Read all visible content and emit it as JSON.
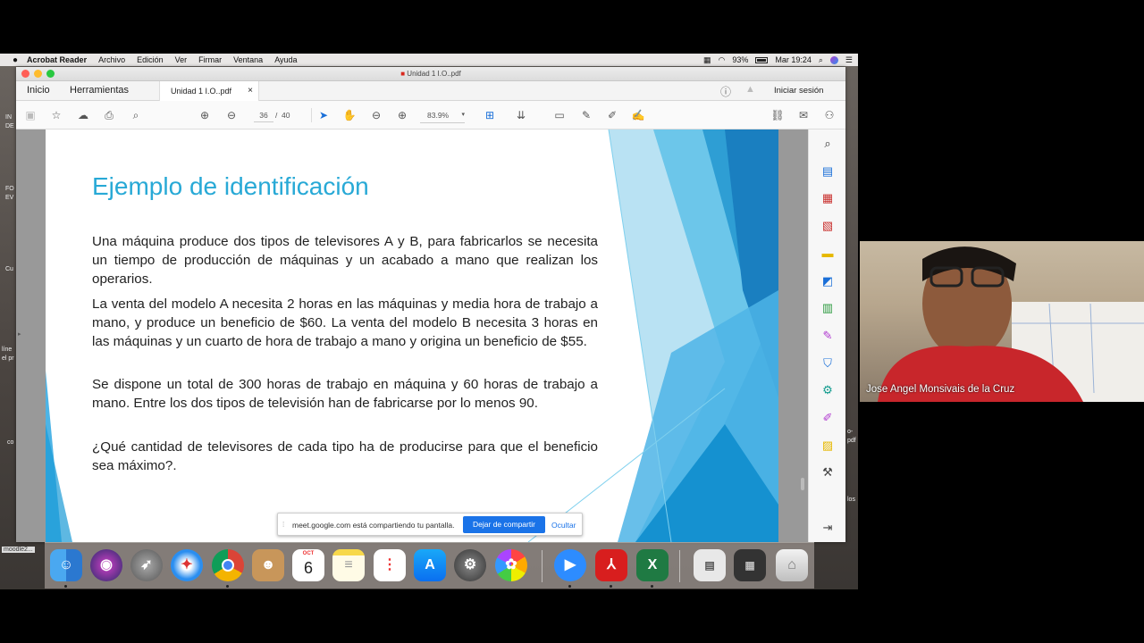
{
  "menubar": {
    "app": "Acrobat Reader",
    "items": [
      "Archivo",
      "Edición",
      "Ver",
      "Firmar",
      "Ventana",
      "Ayuda"
    ],
    "battery": "93%",
    "clock": "Mar 19:24"
  },
  "window": {
    "title": "Unidad 1 I.O..pdf"
  },
  "tabs": {
    "home": "Inicio",
    "tools": "Herramientas",
    "doc": "Unidad 1 I.O..pdf",
    "signin": "Iniciar sesión"
  },
  "toolbar": {
    "page_current": "36",
    "page_sep": "/",
    "page_total": "40",
    "zoom": "83.9%"
  },
  "slide": {
    "title": "Ejemplo de identificación",
    "p1": "Una máquina produce dos tipos de televisores A y B, para fabricarlos se necesita un tiempo de producción de máquinas y un acabado a mano que realizan los operarios.",
    "p2": "La venta del modelo A necesita 2 horas en las máquinas y media hora de trabajo a mano, y produce un beneficio de $60. La venta del modelo B necesita 3 horas en las máquinas y un cuarto de hora de trabajo a mano y origina un beneficio de $55.",
    "p3": "Se dispone un total de 300 horas de trabajo en máquina y 60 horas de trabajo a mano. Entre los dos tipos de televisión han de fabricarse por lo menos 90.",
    "p4": "¿Qué cantidad de televisores de cada tipo ha de producirse para que el beneficio sea máximo?."
  },
  "sharebar": {
    "message": "meet.google.com está compartiendo tu pantalla.",
    "stop": "Dejar de compartir",
    "hide": "Ocultar"
  },
  "dock": {
    "calendar_month": "OCT",
    "calendar_day": "6"
  },
  "webcam": {
    "name": "Jose Angel Monsivais de la Cruz"
  },
  "desktop": {
    "moodle_label": "moodle2..."
  }
}
